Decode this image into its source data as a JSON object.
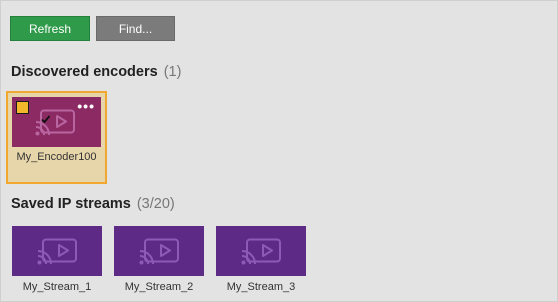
{
  "toolbar": {
    "refresh_label": "Refresh",
    "find_label": "Find..."
  },
  "discovered": {
    "title": "Discovered encoders",
    "count": "(1)",
    "items": [
      {
        "name": "My_Encoder100",
        "selected": true
      }
    ]
  },
  "saved": {
    "title": "Saved IP streams",
    "count": "(3/20)",
    "items": [
      {
        "name": "My_Stream_1"
      },
      {
        "name": "My_Stream_2"
      },
      {
        "name": "My_Stream_3"
      }
    ]
  },
  "colors": {
    "refresh_button": "#2f9a49",
    "find_button": "#7b7b7b",
    "encoder_tile": "#8c2a64",
    "stream_tile": "#5d2a86",
    "selection_border": "#f0a830",
    "selection_fill": "#e8d6ab"
  },
  "icons": {
    "tile_icon": "cast-icon",
    "more": "more-dots-icon",
    "check": "checkbox-checked-icon"
  }
}
